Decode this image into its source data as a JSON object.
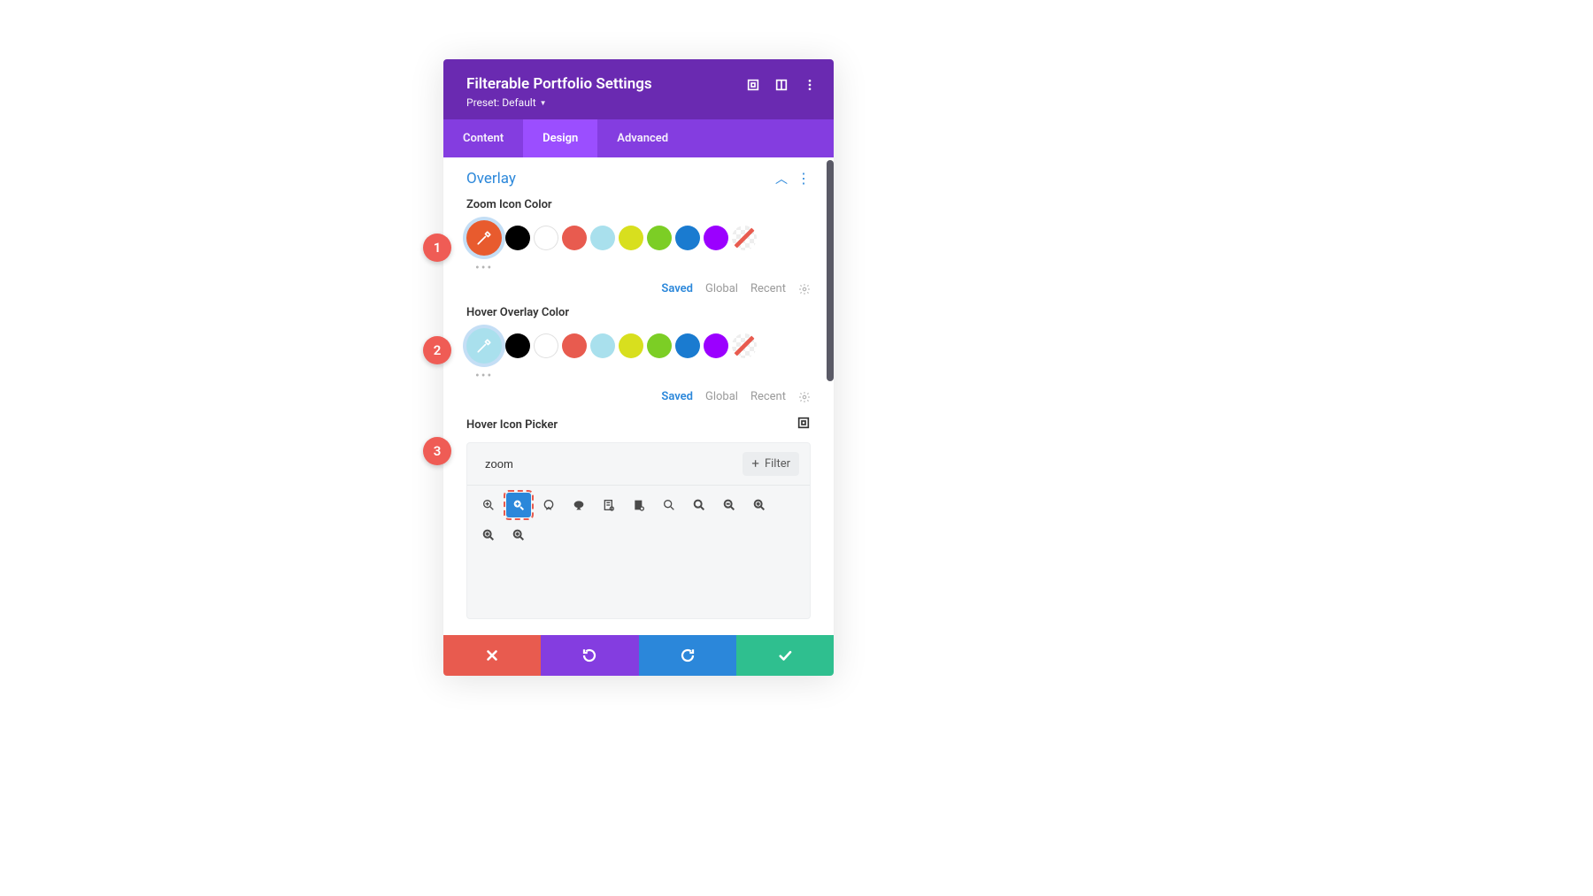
{
  "header": {
    "title": "Filterable Portfolio Settings",
    "preset_label": "Preset: Default"
  },
  "tabs": {
    "content": "Content",
    "design": "Design",
    "advanced": "Advanced",
    "active": "design"
  },
  "section": {
    "title": "Overlay"
  },
  "zoom_icon_color": {
    "label": "Zoom Icon Color",
    "custom": "#e85b2e",
    "swatches": [
      "#000000",
      "#ffffff",
      "#e85b4f",
      "#a9e0ed",
      "#d8df1e",
      "#7cce25",
      "#1a7bd0",
      "#9b00ff"
    ],
    "links": {
      "saved": "Saved",
      "global": "Global",
      "recent": "Recent"
    }
  },
  "hover_overlay_color": {
    "label": "Hover Overlay Color",
    "custom": "#a9e0ed",
    "swatches": [
      "#000000",
      "#ffffff",
      "#e85b4f",
      "#a9e0ed",
      "#d8df1e",
      "#7cce25",
      "#1a7bd0",
      "#9b00ff"
    ],
    "links": {
      "saved": "Saved",
      "global": "Global",
      "recent": "Recent"
    }
  },
  "icon_picker": {
    "label": "Hover Icon Picker",
    "search_value": "zoom",
    "filter_label": "Filter",
    "selected_index": 1,
    "icons": [
      "magnify-plus-outline",
      "magnify-plus-solid",
      "chat-outline",
      "chat-solid",
      "receipt-outline",
      "receipt-solid",
      "search-outline",
      "search-bold",
      "search-minus",
      "search-plus",
      "search-plus2",
      "search-alt"
    ]
  },
  "footer": {
    "cancel": "cancel",
    "undo": "undo",
    "redo": "redo",
    "save": "save"
  },
  "annotations": {
    "a1": "1",
    "a2": "2",
    "a3": "3"
  }
}
